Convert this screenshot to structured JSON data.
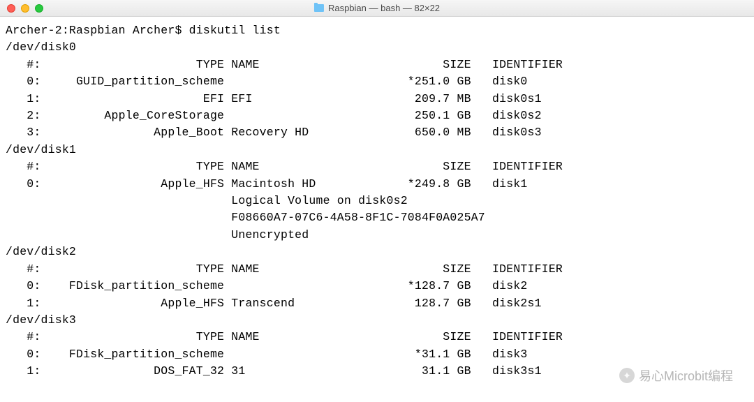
{
  "titlebar": {
    "title": "Raspbian — bash — 82×22"
  },
  "prompt": "Archer-2:Raspbian Archer$ diskutil list",
  "disks": [
    {
      "device": "/dev/disk0",
      "header": {
        "num": "#:",
        "type": "TYPE",
        "name": "NAME",
        "size": "SIZE",
        "identifier": "IDENTIFIER"
      },
      "rows": [
        {
          "num": "0:",
          "type": "GUID_partition_scheme",
          "name": "",
          "size": "*251.0 GB",
          "identifier": "disk0"
        },
        {
          "num": "1:",
          "type": "EFI",
          "name": "EFI",
          "size": "209.7 MB",
          "identifier": "disk0s1"
        },
        {
          "num": "2:",
          "type": "Apple_CoreStorage",
          "name": "",
          "size": "250.1 GB",
          "identifier": "disk0s2"
        },
        {
          "num": "3:",
          "type": "Apple_Boot",
          "name": "Recovery HD",
          "size": "650.0 MB",
          "identifier": "disk0s3"
        }
      ]
    },
    {
      "device": "/dev/disk1",
      "header": {
        "num": "#:",
        "type": "TYPE",
        "name": "NAME",
        "size": "SIZE",
        "identifier": "IDENTIFIER"
      },
      "rows": [
        {
          "num": "0:",
          "type": "Apple_HFS",
          "name": "Macintosh HD",
          "size": "*249.8 GB",
          "identifier": "disk1"
        }
      ],
      "extra": [
        "Logical Volume on disk0s2",
        "F08660A7-07C6-4A58-8F1C-7084F0A025A7",
        "Unencrypted"
      ]
    },
    {
      "device": "/dev/disk2",
      "header": {
        "num": "#:",
        "type": "TYPE",
        "name": "NAME",
        "size": "SIZE",
        "identifier": "IDENTIFIER"
      },
      "rows": [
        {
          "num": "0:",
          "type": "FDisk_partition_scheme",
          "name": "",
          "size": "*128.7 GB",
          "identifier": "disk2"
        },
        {
          "num": "1:",
          "type": "Apple_HFS",
          "name": "Transcend",
          "size": "128.7 GB",
          "identifier": "disk2s1"
        }
      ]
    },
    {
      "device": "/dev/disk3",
      "header": {
        "num": "#:",
        "type": "TYPE",
        "name": "NAME",
        "size": "SIZE",
        "identifier": "IDENTIFIER"
      },
      "rows": [
        {
          "num": "0:",
          "type": "FDisk_partition_scheme",
          "name": "",
          "size": "*31.1 GB",
          "identifier": "disk3"
        },
        {
          "num": "1:",
          "type": "DOS_FAT_32",
          "name": "31",
          "size": "31.1 GB",
          "identifier": "disk3s1"
        }
      ]
    }
  ],
  "watermark": {
    "text": "易心Microbit编程"
  }
}
